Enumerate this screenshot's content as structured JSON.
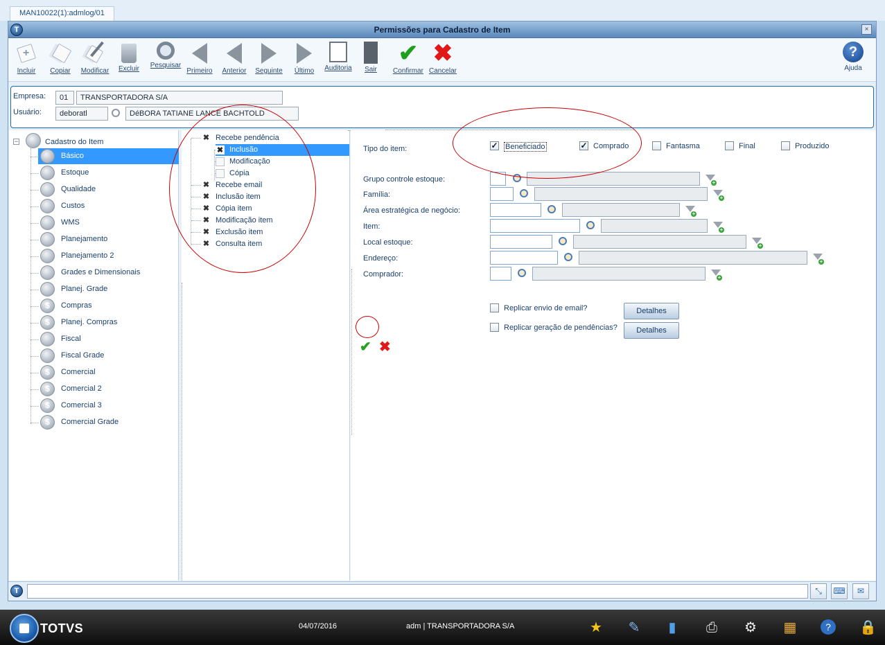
{
  "app_tab": "MAN10022(1):admlog/01",
  "window": {
    "title": "Permissões para Cadastro de Item",
    "logo_letter": "T",
    "close_label": "×"
  },
  "toolbar": {
    "buttons": [
      {
        "label": "Incluir",
        "icon": "add-document-icon"
      },
      {
        "label": "Copiar",
        "icon": "copy-icon"
      },
      {
        "label": "Modificar",
        "icon": "edit-icon"
      },
      {
        "label": "Excluir",
        "icon": "trash-icon"
      },
      {
        "label": "Pesquisar",
        "icon": "search-icon"
      },
      {
        "label": "Primeiro",
        "icon": "first-icon"
      },
      {
        "label": "Anterior",
        "icon": "previous-icon"
      },
      {
        "label": "Seguinte",
        "icon": "next-icon"
      },
      {
        "label": "Último",
        "icon": "last-icon"
      },
      {
        "label": "Auditoria",
        "icon": "audit-icon"
      },
      {
        "label": "Sair",
        "icon": "exit-icon"
      },
      {
        "label": "Confirmar",
        "icon": "check-icon"
      },
      {
        "label": "Cancelar",
        "icon": "cancel-icon"
      }
    ],
    "help_label": "Ajuda",
    "help_glyph": "?"
  },
  "header": {
    "empresa_label": "Empresa:",
    "empresa_code": "01",
    "empresa_name": "TRANSPORTADORA S/A",
    "usuario_label": "Usuário:",
    "usuario_code": "deboratl",
    "usuario_name": "DéBORA TATIANE LANCE BACHTOLD"
  },
  "left_tree": {
    "root": "Cadastro do Item",
    "items": [
      {
        "label": "Básico",
        "selected": true,
        "icon": "minus-circle-icon"
      },
      {
        "label": "Estoque",
        "icon": "boxes-icon"
      },
      {
        "label": "Qualidade",
        "icon": "minus-circle-icon"
      },
      {
        "label": "Custos",
        "icon": "scale-icon"
      },
      {
        "label": "WMS",
        "icon": "wms-icon"
      },
      {
        "label": "Planejamento",
        "icon": "person-icon"
      },
      {
        "label": "Planejamento 2",
        "icon": "person-icon"
      },
      {
        "label": "Grades e Dimensionais",
        "icon": "grid-icon"
      },
      {
        "label": "Planej. Grade",
        "icon": "grid-icon"
      },
      {
        "label": "Compras",
        "icon": "dollar-icon"
      },
      {
        "label": "Planej. Compras",
        "icon": "dollar-icon"
      },
      {
        "label": "Fiscal",
        "icon": "scale-icon"
      },
      {
        "label": "Fiscal Grade",
        "icon": "scale-icon"
      },
      {
        "label": "Comercial",
        "icon": "dollar-icon"
      },
      {
        "label": "Comercial 2",
        "icon": "dollar-icon"
      },
      {
        "label": "Comercial 3",
        "icon": "dollar-icon"
      },
      {
        "label": "Comercial Grade",
        "icon": "dollar-icon"
      }
    ]
  },
  "permissions_tree": {
    "items": [
      {
        "label": "Recebe pendência",
        "checked": true,
        "level": 0
      },
      {
        "label": "Inclusão",
        "checked": true,
        "level": 1,
        "selected": true
      },
      {
        "label": "Modificação",
        "checked": false,
        "level": 1
      },
      {
        "label": "Cópia",
        "checked": false,
        "level": 1
      },
      {
        "label": "Recebe email",
        "checked": true,
        "level": 0
      },
      {
        "label": "Inclusão item",
        "checked": true,
        "level": 0
      },
      {
        "label": "Cópia item",
        "checked": true,
        "level": 0
      },
      {
        "label": "Modificação item",
        "checked": true,
        "level": 0
      },
      {
        "label": "Exclusão item",
        "checked": true,
        "level": 0
      },
      {
        "label": "Consulta item",
        "checked": true,
        "level": 0
      }
    ]
  },
  "form": {
    "tipo_label": "Tipo do item:",
    "tipos": [
      {
        "label": "Beneficiado",
        "checked": true
      },
      {
        "label": "Comprado",
        "checked": true
      },
      {
        "label": "Fantasma",
        "checked": false
      },
      {
        "label": "Final",
        "checked": false
      },
      {
        "label": "Produzido",
        "checked": false
      }
    ],
    "fields": [
      {
        "label": "Grupo controle estoque:",
        "value": "",
        "desc": ""
      },
      {
        "label": "Família:",
        "value": "",
        "desc": ""
      },
      {
        "label": "Área estratégica de negócio:",
        "value": "",
        "desc": ""
      },
      {
        "label": "Item:",
        "value": "",
        "desc": ""
      },
      {
        "label": "Local estoque:",
        "value": "",
        "desc": ""
      },
      {
        "label": "Endereço:",
        "value": "",
        "desc": ""
      },
      {
        "label": "Comprador:",
        "value": "",
        "desc": ""
      }
    ],
    "replicar_email": {
      "label": "Replicar envio de email?",
      "checked": false,
      "button": "Detalhes"
    },
    "replicar_pendencias": {
      "label": "Replicar geração de pendências?",
      "checked": false,
      "button": "Detalhes"
    },
    "ok_glyph": "✔",
    "cancel_glyph": "✖"
  },
  "taskbar": {
    "brand": "TOTVS",
    "date": "04/07/2016",
    "session": "adm | TRANSPORTADORA S/A"
  }
}
